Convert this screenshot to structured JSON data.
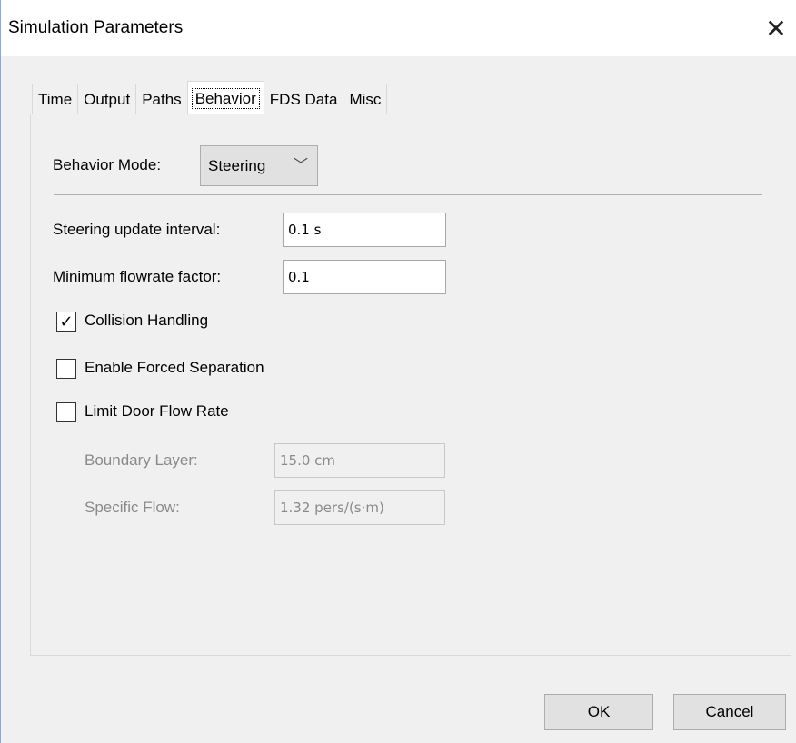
{
  "window": {
    "title": "Simulation Parameters"
  },
  "tabs": [
    {
      "label": "Time"
    },
    {
      "label": "Output"
    },
    {
      "label": "Paths"
    },
    {
      "label": "Behavior"
    },
    {
      "label": "FDS Data"
    },
    {
      "label": "Misc"
    }
  ],
  "active_tab": "Behavior",
  "behavior": {
    "mode_label": "Behavior Mode:",
    "mode_value": "Steering",
    "steering_interval_label": "Steering update interval:",
    "steering_interval_value": "0.1 s",
    "min_flowrate_label": "Minimum flowrate factor:",
    "min_flowrate_value": "0.1",
    "collision_label": "Collision Handling",
    "collision_checked": true,
    "forced_sep_label": "Enable Forced Separation",
    "forced_sep_checked": false,
    "limit_door_label": "Limit Door Flow Rate",
    "limit_door_checked": false,
    "boundary_layer_label": "Boundary Layer:",
    "boundary_layer_value": "15.0 cm",
    "specific_flow_label": "Specific Flow:",
    "specific_flow_value": "1.32 pers/(s·m)"
  },
  "buttons": {
    "ok": "OK",
    "cancel": "Cancel"
  },
  "icons": {
    "close": "close-icon",
    "dropdown": "chevron-down-icon",
    "check": "checkmark-icon"
  }
}
